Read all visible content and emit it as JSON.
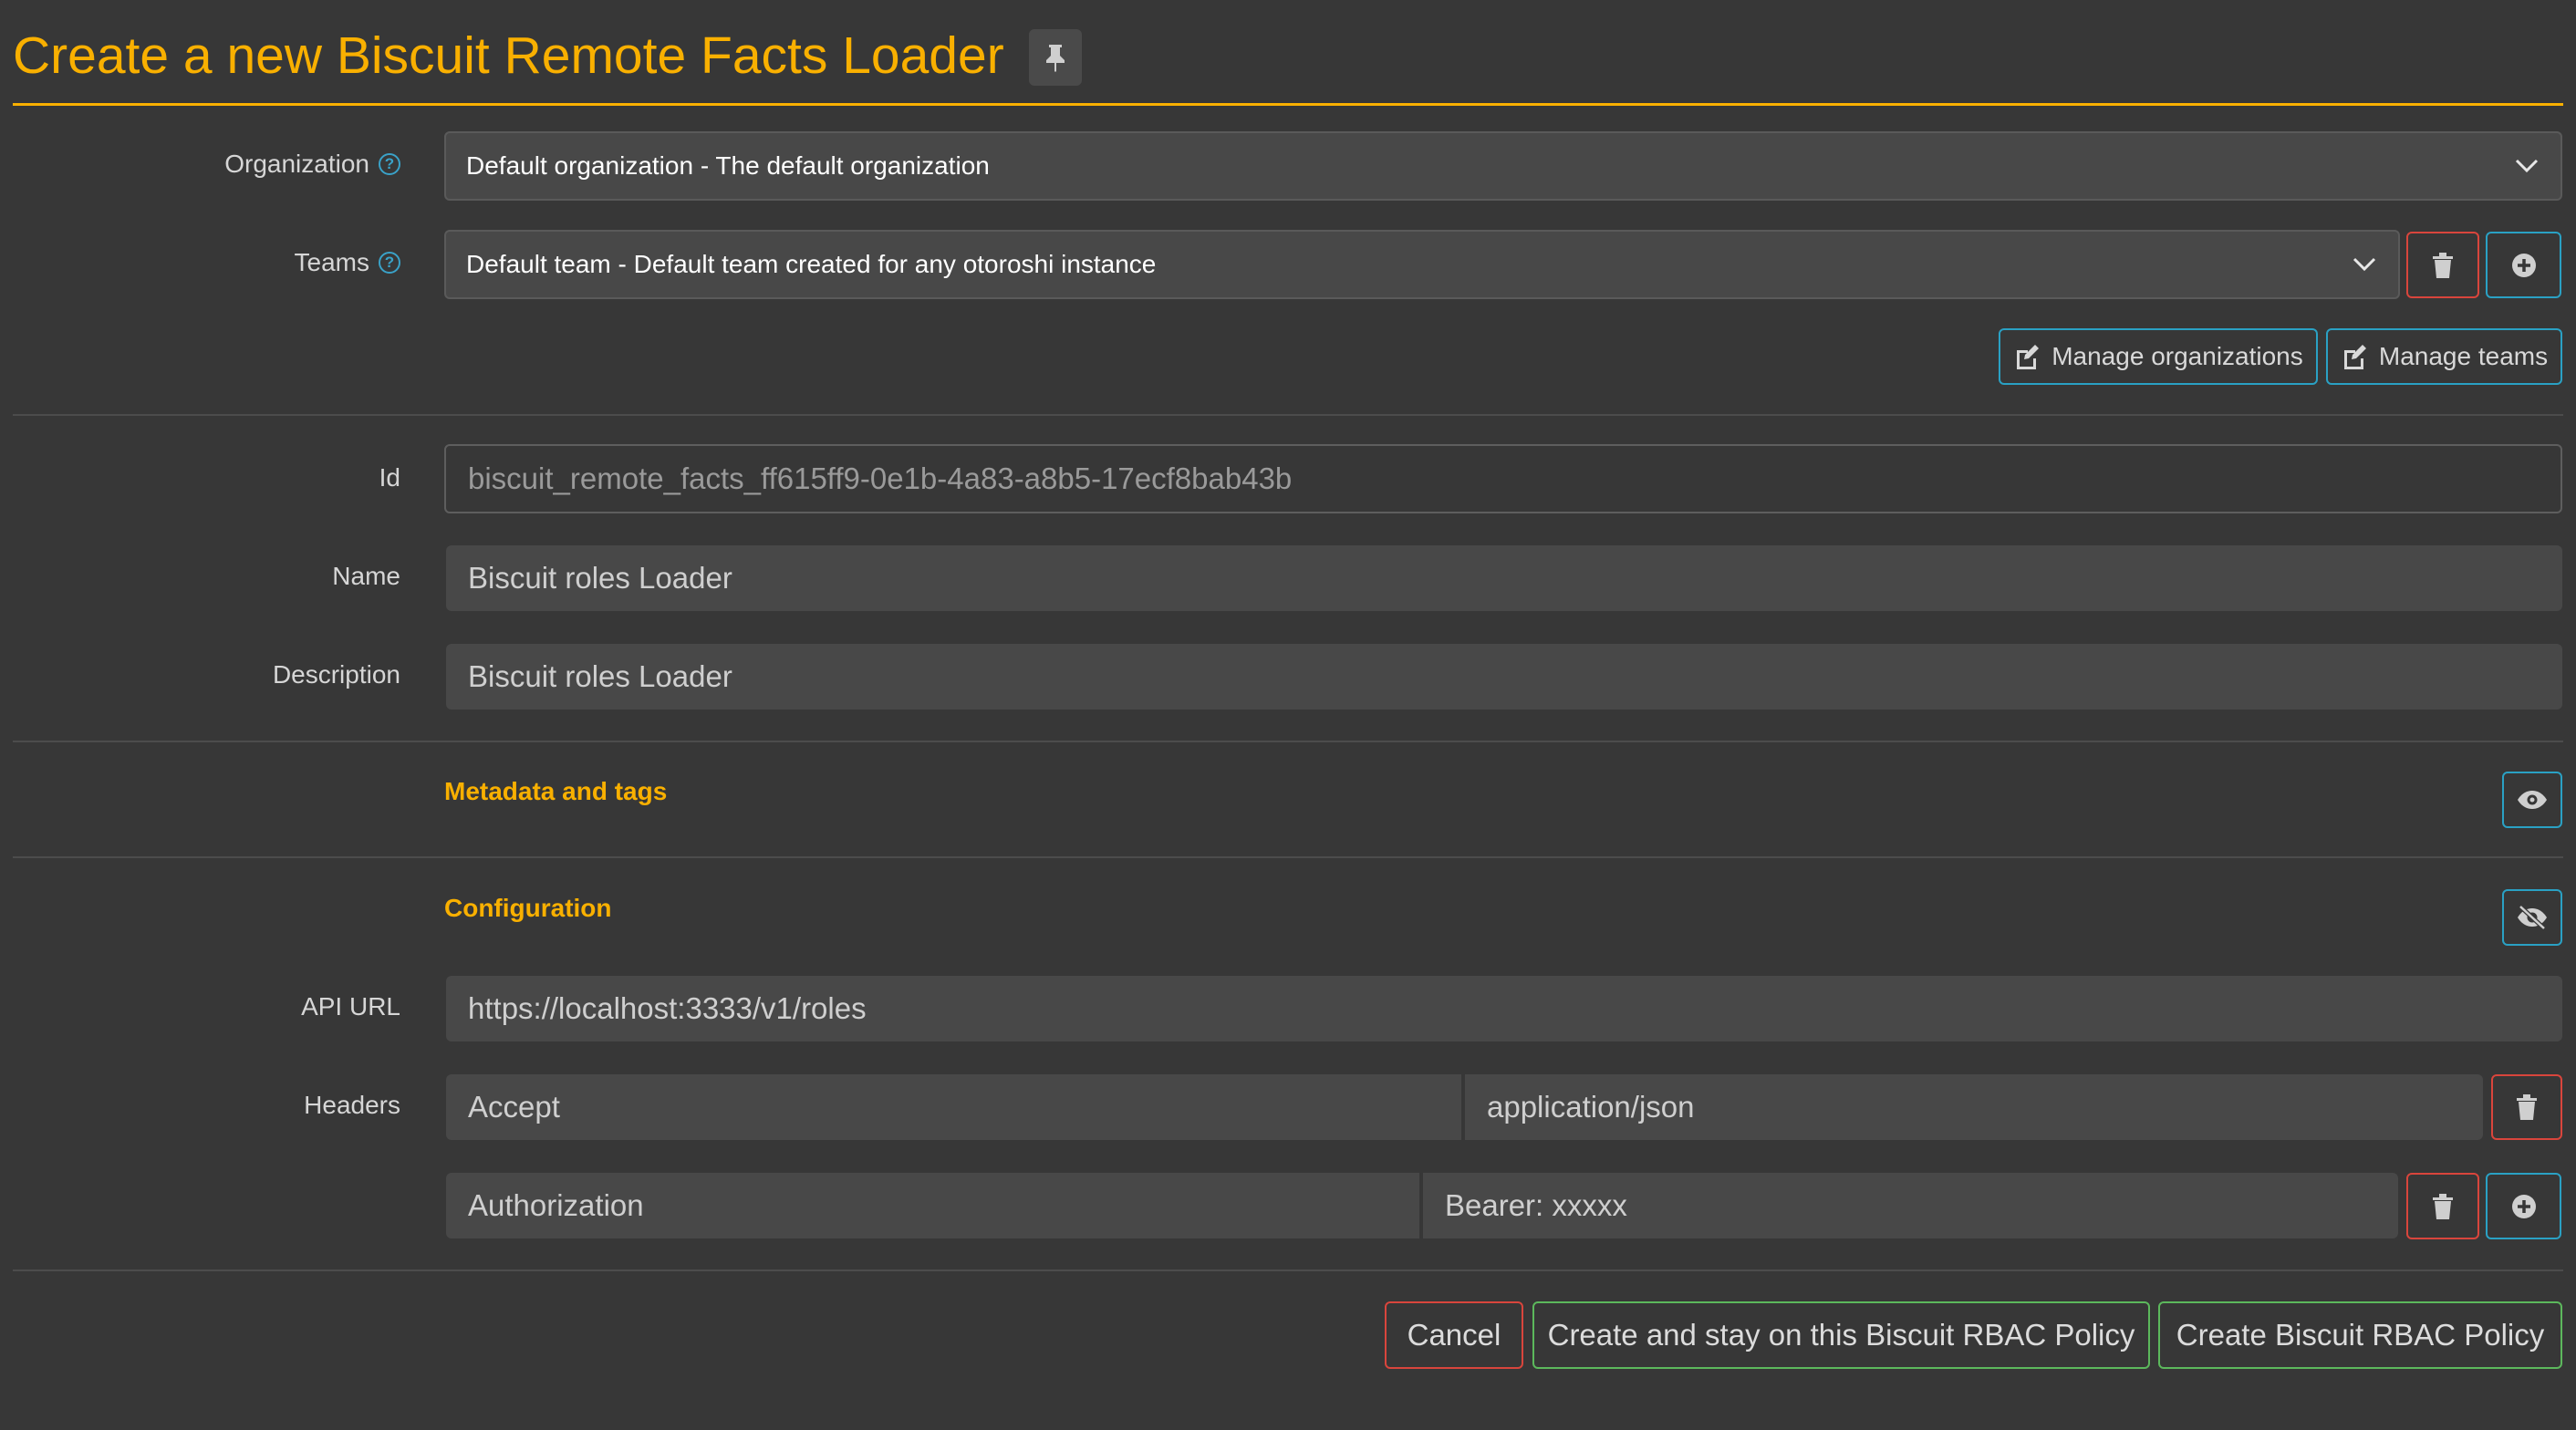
{
  "header": {
    "title": "Create a new Biscuit Remote Facts Loader",
    "pin_icon": "pin-icon"
  },
  "organization": {
    "label": "Organization",
    "value": "Default organization - The default organization"
  },
  "teams": {
    "label": "Teams",
    "value": "Default team - Default team created for any otoroshi instance"
  },
  "manage": {
    "organizations_label": "Manage organizations",
    "teams_label": "Manage teams"
  },
  "fields": {
    "id": {
      "label": "Id",
      "value": "biscuit_remote_facts_ff615ff9-0e1b-4a83-a8b5-17ecf8bab43b"
    },
    "name": {
      "label": "Name",
      "value": "Biscuit roles Loader"
    },
    "description": {
      "label": "Description",
      "value": "Biscuit roles Loader"
    }
  },
  "sections": {
    "metadata": "Metadata and tags",
    "configuration": "Configuration"
  },
  "config": {
    "api_url_label": "API URL",
    "api_url": "https://localhost:3333/v1/roles",
    "headers_label": "Headers",
    "headers": [
      {
        "key": "Accept",
        "value": "application/json"
      },
      {
        "key": "Authorization",
        "value": "Bearer: xxxxx"
      }
    ]
  },
  "footer": {
    "cancel": "Cancel",
    "create_stay": "Create and stay on this Biscuit RBAC Policy",
    "create": "Create Biscuit RBAC Policy"
  },
  "colors": {
    "accent": "#f9b000",
    "info": "#2aa1c4",
    "danger": "#d9453c",
    "success": "#5cb85c",
    "background": "#373737"
  }
}
